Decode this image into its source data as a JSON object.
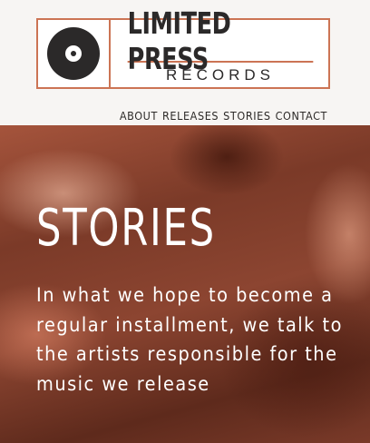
{
  "logo": {
    "icon": "vinyl-record-icon",
    "title": "LIMITED PRESS",
    "subtitle": "RECORDS"
  },
  "nav": {
    "items": [
      "ABOUT",
      "RELEASES",
      "STORIES",
      "CONTACT"
    ]
  },
  "hero": {
    "heading": "STORIES",
    "text": "In what we hope to become a regular installment, we talk to the artists responsible for the music we release"
  },
  "colors": {
    "accent": "#cc7454",
    "ink": "#2b2929",
    "hero_base": "#7b3a28"
  }
}
